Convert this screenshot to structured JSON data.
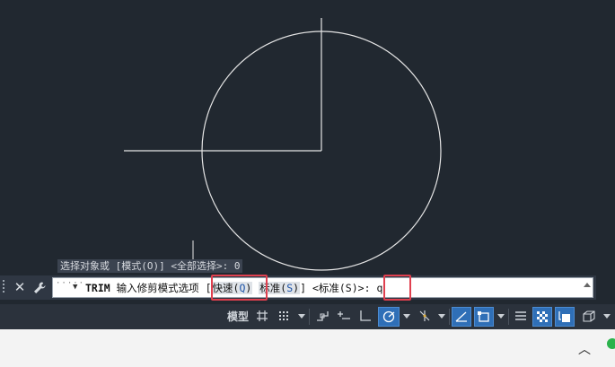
{
  "history": {
    "text": "选择对象或 [模式(O)] <全部选择>: 0"
  },
  "command": {
    "close_icon": "close-icon",
    "settings_icon": "wrench-icon",
    "name": "TRIM",
    "prompt": "输入修剪模式选项",
    "bracket_open": "[",
    "option1_label": "快速",
    "option1_key_open": "(",
    "option1_key": "Q",
    "option1_key_close": ")",
    "option2_label": "标准",
    "option2_key_open": "(",
    "option2_key": "S",
    "option2_key_close": ")",
    "bracket_close": "]",
    "default": "<标准(S)>:",
    "input_value": "q"
  },
  "statusbar": {
    "model_label": "模型",
    "icons": [
      "grid-icon",
      "snap-grid-icon",
      "infer-constraints-icon",
      "dynamic-input-icon",
      "ortho-icon",
      "polar-tracking-icon",
      "isodraft-icon",
      "object-snap-tracking-icon",
      "object-snap-icon",
      "lineweight-icon",
      "transparency-icon",
      "selection-cycling-icon",
      "3d-object-snap-icon"
    ]
  },
  "colors": {
    "canvas_bg": "#212830",
    "drawing_line": "#ffffff",
    "highlight_box": "#e0404f",
    "active_toggle": "#2f6fb7"
  }
}
